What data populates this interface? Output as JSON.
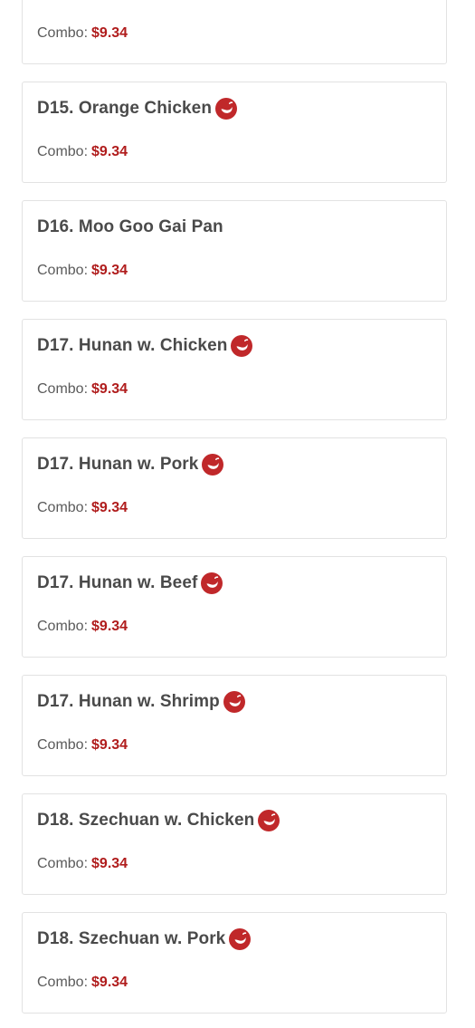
{
  "colors": {
    "price": "#b01c1c",
    "spicy_icon": "#c0282a",
    "title": "#4a4a4a",
    "card_border": "#e2e2e2"
  },
  "items": [
    {
      "title": "",
      "spicy": false,
      "combo_label": "Combo:",
      "price": "$9.34"
    },
    {
      "title": "D15. Orange Chicken",
      "spicy": true,
      "combo_label": "Combo:",
      "price": "$9.34"
    },
    {
      "title": "D16. Moo Goo Gai Pan",
      "spicy": false,
      "combo_label": "Combo:",
      "price": "$9.34"
    },
    {
      "title": "D17. Hunan w. Chicken",
      "spicy": true,
      "combo_label": "Combo:",
      "price": "$9.34"
    },
    {
      "title": "D17. Hunan w. Pork",
      "spicy": true,
      "combo_label": "Combo:",
      "price": "$9.34"
    },
    {
      "title": "D17. Hunan w. Beef",
      "spicy": true,
      "combo_label": "Combo:",
      "price": "$9.34"
    },
    {
      "title": "D17. Hunan w. Shrimp",
      "spicy": true,
      "combo_label": "Combo:",
      "price": "$9.34"
    },
    {
      "title": "D18. Szechuan w. Chicken",
      "spicy": true,
      "combo_label": "Combo:",
      "price": "$9.34"
    },
    {
      "title": "D18. Szechuan w. Pork",
      "spicy": true,
      "combo_label": "Combo:",
      "price": "$9.34"
    }
  ]
}
